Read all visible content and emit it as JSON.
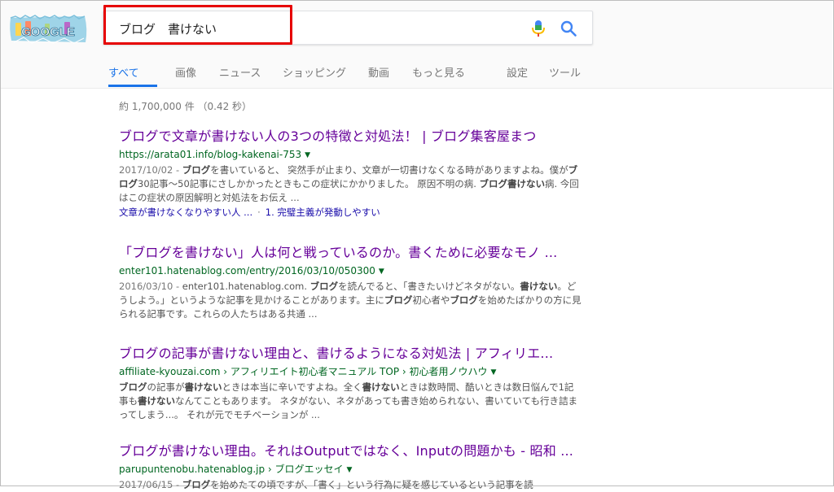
{
  "logo": {
    "text": "GOOGLE"
  },
  "search": {
    "query": "ブログ　書けない"
  },
  "tabs": [
    {
      "label": "すべて"
    },
    {
      "label": "画像"
    },
    {
      "label": "ニュース"
    },
    {
      "label": "ショッピング"
    },
    {
      "label": "動画"
    },
    {
      "label": "もっと見る"
    },
    {
      "label": "設定"
    },
    {
      "label": "ツール"
    }
  ],
  "stats": "約 1,700,000 件 （0.42 秒）",
  "results": [
    {
      "title": "ブログで文章が書けない人の3つの特徴と対処法！ | ブログ集客屋まつ",
      "url": "https://arata01.info/blog-kakenai-753",
      "date": "2017/10/02 - ",
      "snippet_a": "ブログ",
      "snippet_b": "を書いていると、 突然手が止まり、文章が一切書けなくなる時がありますよね。僕が",
      "snippet_c": "ブログ",
      "snippet_d": "30記事〜50記事にさしかかったときもこの症状にかかりました。 原因不明の病. ",
      "snippet_e": "ブログ書けない",
      "snippet_f": "病. 今回はこの症状の原因解明と対処法をお伝え ...",
      "link1": "文章が書けなくなりやすい人 ...",
      "link2": "1. 完璧主義が発動しやすい"
    },
    {
      "title": "「ブログを書けない」人は何と戦っているのか。書くために必要なモノ ...",
      "url": "enter101.hatenablog.com/entry/2016/03/10/050300",
      "date": "2016/03/10 - ",
      "snippet_a": "enter101.hatenablog.com. ",
      "snippet_b": "ブログ",
      "snippet_c": "を読んでると、「書きたいけどネタがない。",
      "snippet_d": "書けない",
      "snippet_e": "。どうしよう。」というような記事を見かけることがあります。主に",
      "snippet_f": "ブログ",
      "snippet_g": "初心者や",
      "snippet_h": "ブログ",
      "snippet_i": "を始めたばかりの方に見られる記事です。これらの人たちはある共通 ..."
    },
    {
      "title": "ブログの記事が書けない理由と、書けるようになる対処法 | アフィリエ...",
      "url": "affiliate-kyouzai.com › アフィリエイト初心者マニュアル TOP › 初心者用ノウハウ",
      "snippet_a": "ブログ",
      "snippet_b": "の記事が",
      "snippet_c": "書けない",
      "snippet_d": "ときは本当に辛いですよね。全く",
      "snippet_e": "書けない",
      "snippet_f": "ときは数時間、酷いときは数日悩んで1記事も",
      "snippet_g": "書けない",
      "snippet_h": "なんてこともあります。 ネタがない、ネタがあっても書き始められない、書いていても行き詰まってしまう...。 それが元でモチベーションが ..."
    },
    {
      "title": "ブログが書けない理由。それはOutputではなく、Inputの問題かも - 昭和 ...",
      "url": "parupuntenobu.hatenablog.jp › ブログエッセイ",
      "date": "2017/06/15 - ",
      "snippet_a": "ブログ",
      "snippet_b": "を始めたての頃ですが、「書く」という行為に疑を感じているという記事を読"
    }
  ]
}
